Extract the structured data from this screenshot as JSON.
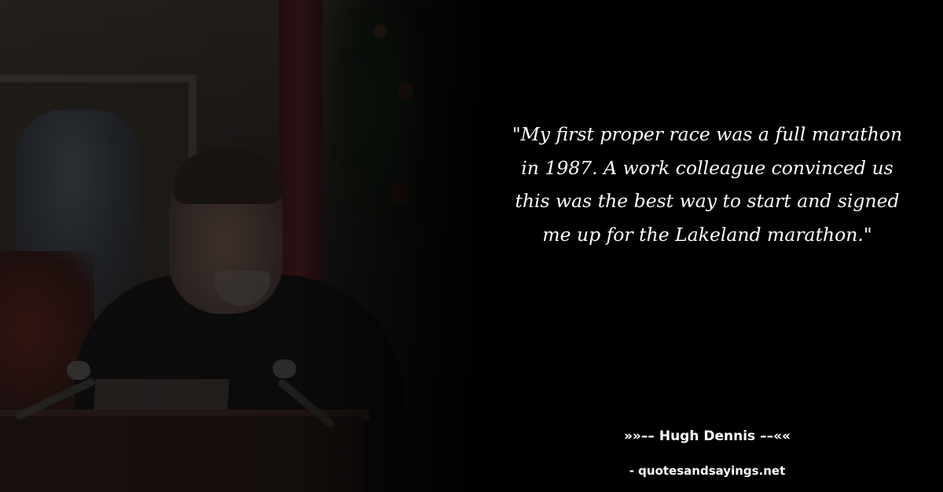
{
  "quote": {
    "text": "\"My first proper race was a full marathon in 1987. A work colleague convinced us this was the best way to start and signed me up for the Lakeland marathon.\""
  },
  "author": {
    "label": "»»–– Hugh Dennis ––««"
  },
  "source": {
    "label": "- quotesandsayings.net"
  },
  "colors": {
    "background": "#000000",
    "text": "#ffffff"
  }
}
